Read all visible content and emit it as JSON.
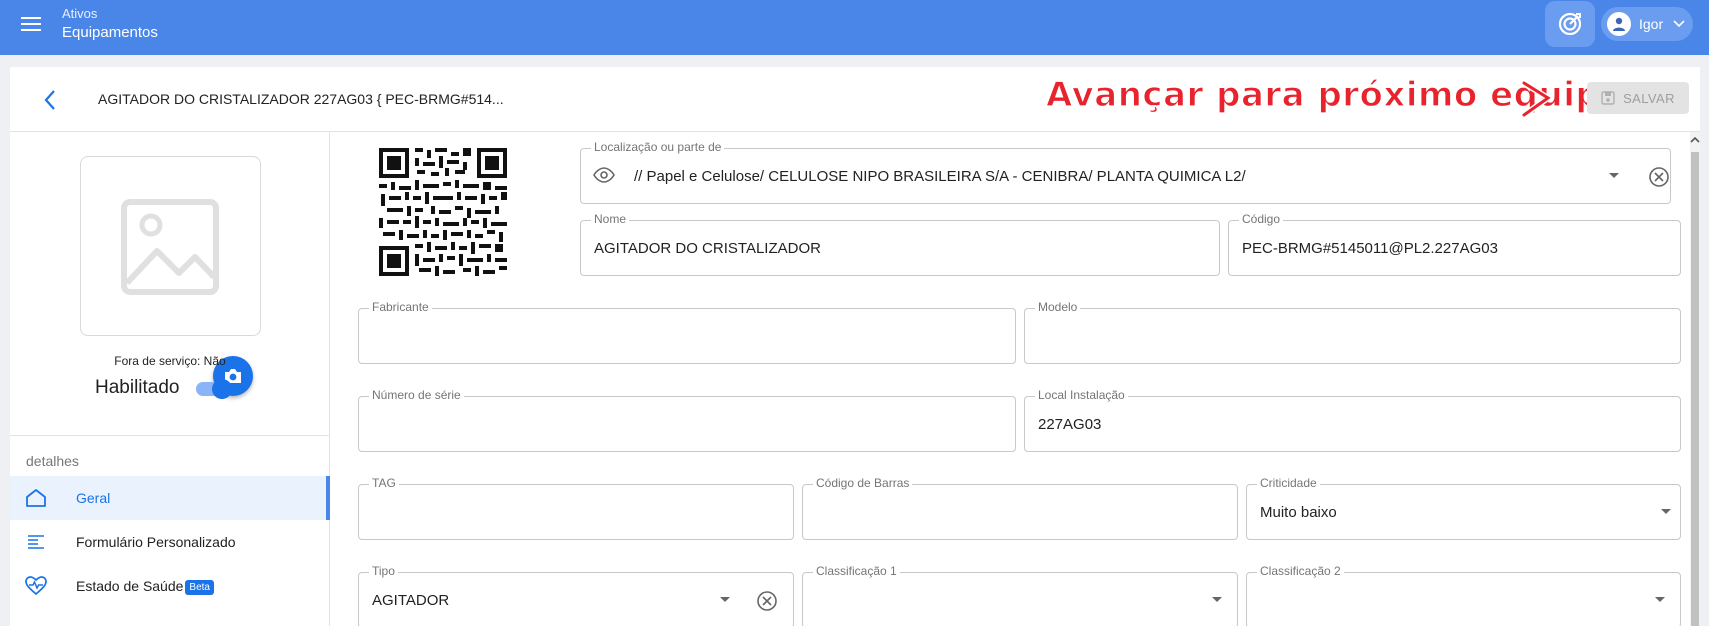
{
  "appbar": {
    "section": "Ativos",
    "page": "Equipamentos",
    "user": {
      "name": "Igor"
    }
  },
  "header": {
    "title": "AGITADOR DO CRISTALIZADOR 227AG03 { PEC-BRMG#514...",
    "annotation": "Avançar para próximo equip.",
    "save_label": "SALVAR"
  },
  "left": {
    "out_of_service": "Fora de serviço: Não",
    "enabled_label": "Habilitado",
    "enabled": true,
    "section_label": "detalhes",
    "nav": [
      {
        "label": "Geral",
        "icon": "home-icon",
        "active": true
      },
      {
        "label": "Formulário Personalizado",
        "icon": "form-list-icon",
        "active": false
      },
      {
        "label": "Estado de Saúde",
        "icon": "heart-pulse-icon",
        "active": false,
        "badge": "Beta"
      }
    ]
  },
  "form": {
    "location": {
      "label": "Localização ou parte de",
      "value": "// Papel e Celulose/ CELULOSE NIPO BRASILEIRA S/A - CENIBRA/ PLANTA QUIMICA L2/"
    },
    "name": {
      "label": "Nome",
      "value": "AGITADOR DO CRISTALIZADOR"
    },
    "code": {
      "label": "Código",
      "value": "PEC-BRMG#5145011@PL2.227AG03"
    },
    "manufacturer": {
      "label": "Fabricante",
      "value": ""
    },
    "model": {
      "label": "Modelo",
      "value": ""
    },
    "serial": {
      "label": "Número de série",
      "value": ""
    },
    "install_location": {
      "label": "Local Instalação",
      "value": "227AG03"
    },
    "tag": {
      "label": "TAG",
      "value": ""
    },
    "barcode": {
      "label": "Código de Barras",
      "value": ""
    },
    "criticality": {
      "label": "Criticidade",
      "value": "Muito baixo"
    },
    "type": {
      "label": "Tipo",
      "value": "AGITADOR"
    },
    "class1": {
      "label": "Classificação 1",
      "value": ""
    },
    "class2": {
      "label": "Classificação 2",
      "value": ""
    }
  },
  "colors": {
    "appbar": "#4a86e8",
    "accent": "#1a73e8",
    "annotation": "#e8232e"
  }
}
